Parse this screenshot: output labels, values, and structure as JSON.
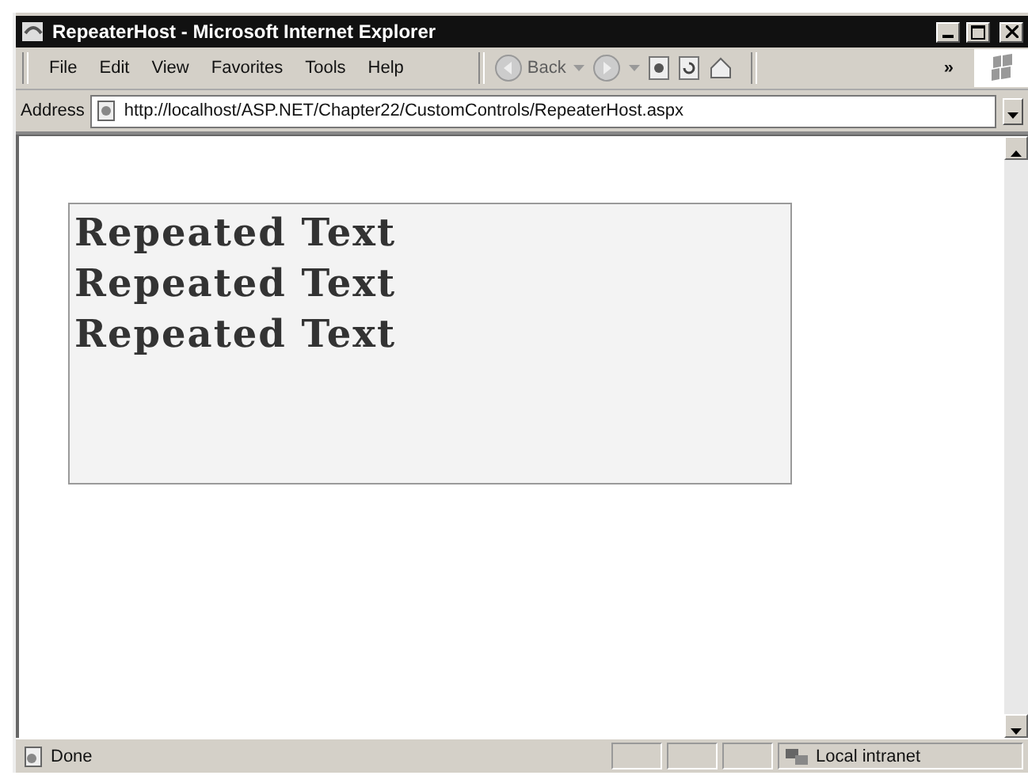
{
  "window": {
    "title": "RepeaterHost - Microsoft Internet Explorer"
  },
  "menu": [
    "File",
    "Edit",
    "View",
    "Favorites",
    "Tools",
    "Help"
  ],
  "toolbar": {
    "back": {
      "label": "Back",
      "disabled": true
    },
    "chevron": "»"
  },
  "address": {
    "label": "Address",
    "value": "http://localhost/ASP.NET/Chapter22/CustomControls/RepeaterHost.aspx"
  },
  "content": {
    "repeated_items": [
      "Repeated Text",
      "Repeated Text",
      "Repeated Text"
    ]
  },
  "status_bar": {
    "text": "Done",
    "zone": "Local intranet"
  }
}
